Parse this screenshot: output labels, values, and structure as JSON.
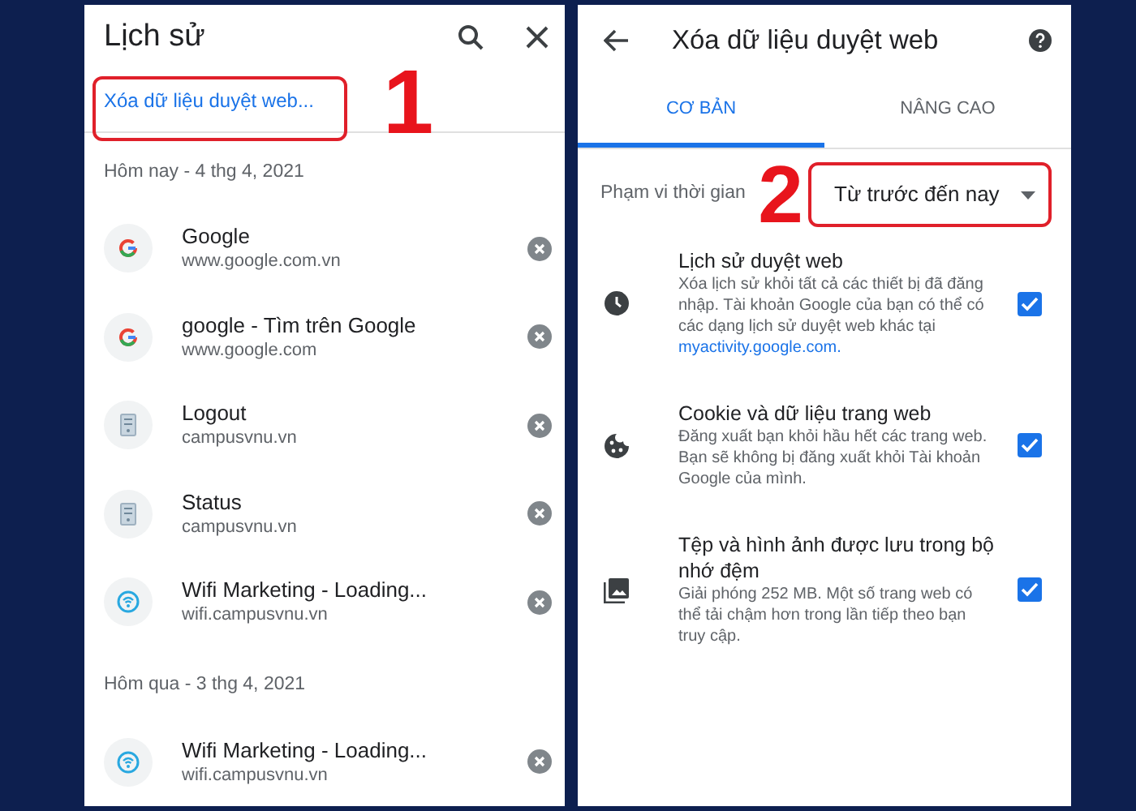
{
  "history": {
    "title": "Lịch sử",
    "clear_link": "Xóa dữ liệu duyệt web...",
    "sections": [
      {
        "heading": "Hôm nay - 4 thg 4, 2021",
        "items": [
          {
            "title": "Google",
            "url": "www.google.com.vn",
            "kind": "google"
          },
          {
            "title": "google - Tìm trên Google",
            "url": "www.google.com",
            "kind": "google"
          },
          {
            "title": "Logout",
            "url": "campusvnu.vn",
            "kind": "server"
          },
          {
            "title": "Status",
            "url": "campusvnu.vn",
            "kind": "server"
          },
          {
            "title": "Wifi Marketing - Loading...",
            "url": "wifi.campusvnu.vn",
            "kind": "wifi"
          }
        ]
      },
      {
        "heading": "Hôm qua - 3 thg 4, 2021",
        "items": [
          {
            "title": "Wifi Marketing - Loading...",
            "url": "wifi.campusvnu.vn",
            "kind": "wifi"
          }
        ]
      }
    ]
  },
  "clear_data": {
    "title": "Xóa dữ liệu duyệt web",
    "tabs": [
      {
        "label": "CƠ BẢN",
        "selected": true
      },
      {
        "label": "NÂNG CAO",
        "selected": false
      }
    ],
    "time_range": {
      "label": "Phạm vi thời gian",
      "value": "Từ trước đến nay"
    },
    "options": [
      {
        "kind": "history",
        "title": "Lịch sử duyệt web",
        "description": "Xóa lịch sử khỏi tất cả các thiết bị đã đăng nhập. Tài khoản Google của bạn có thể có các dạng lịch sử duyệt web khác tại",
        "link": "myactivity.google.com.",
        "checked": true
      },
      {
        "kind": "cookie",
        "title": "Cookie và dữ liệu trang web",
        "description": "Đăng xuất bạn khỏi hầu hết các trang web. Bạn sẽ không bị đăng xuất khỏi Tài khoản Google của mình.",
        "checked": true
      },
      {
        "kind": "cache",
        "title": "Tệp và hình ảnh được lưu trong bộ nhớ đệm",
        "description": "Giải phóng 252 MB. Một số trang web có thể tải chậm hơn trong lần tiếp theo bạn truy cập.",
        "checked": true
      }
    ]
  },
  "annotations": [
    "1",
    "2"
  ]
}
